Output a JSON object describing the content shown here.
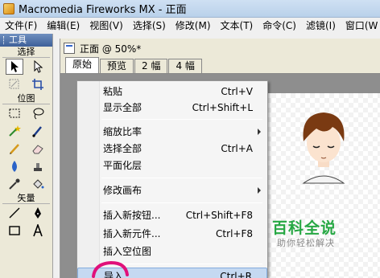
{
  "window": {
    "title": "Macromedia Fireworks MX - 正面"
  },
  "menubar": {
    "items": [
      "文件(F)",
      "编辑(E)",
      "视图(V)",
      "选择(S)",
      "修改(M)",
      "文本(T)",
      "命令(C)",
      "滤镜(I)",
      "窗口(W"
    ]
  },
  "tools": {
    "header": "工具",
    "sections": {
      "select": "选择",
      "bitmap": "位图",
      "vector": "矢量"
    }
  },
  "document": {
    "title": "正面 @ 50%*",
    "tabs": [
      "原始",
      "预览",
      "2 幅",
      "4 幅"
    ],
    "active_tab": "原始"
  },
  "context_menu": {
    "items": [
      {
        "label": "粘贴",
        "shortcut": "Ctrl+V"
      },
      {
        "label": "显示全部",
        "shortcut": "Ctrl+Shift+L"
      },
      {
        "label": "缩放比率",
        "shortcut": ""
      },
      {
        "label": "选择全部",
        "shortcut": "Ctrl+A"
      },
      {
        "label": "平面化层",
        "shortcut": ""
      },
      {
        "label": "修改画布",
        "shortcut": ""
      },
      {
        "label": "插入新按钮...",
        "shortcut": "Ctrl+Shift+F8"
      },
      {
        "label": "插入新元件...",
        "shortcut": "Ctrl+F8"
      },
      {
        "label": "插入空位图",
        "shortcut": ""
      },
      {
        "label": "导入...",
        "shortcut": "Ctrl+R"
      }
    ]
  },
  "watermark": {
    "title": "百科全说",
    "subtitle": "助你轻松解决"
  },
  "colors": {
    "annotation": "#e0117a",
    "watermark": "#27a844",
    "highlight": "#c5d9f1"
  }
}
